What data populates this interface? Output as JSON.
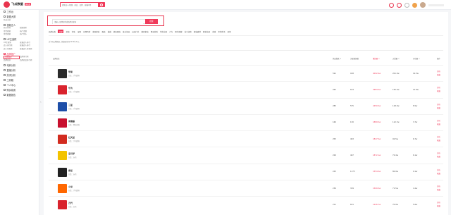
{
  "header": {
    "logo_text": "飞瓜数据",
    "logo_sub": "抖音版",
    "logo_badge": "旗舰版",
    "search_placeholder": "搜索达人/视频、商品、品牌、直播间等",
    "accent_color": "#f03a5a"
  },
  "sidebar": {
    "groups": [
      {
        "label": "工作台",
        "icon": "workbench-icon",
        "subs": []
      },
      {
        "label": "数据大屏",
        "icon": "screen-icon",
        "subs": [
          "作品大屏"
        ]
      },
      {
        "label": "视频达人",
        "icon": "video-icon",
        "subs": [
          "热门素材",
          "视频搜索",
          "带货视频",
          "热门话题",
          "带货视频",
          "热门音乐"
        ]
      },
      {
        "label": "UP主追踪",
        "icon": "track-icon",
        "subs": [
          "UP主搜索",
          "直播达人排行",
          "达人排行榜",
          "直播达人排行",
          "达人带货榜",
          "直播达人带货榜"
        ]
      },
      {
        "label": "品牌推广",
        "icon": "brand-icon",
        "active": true,
        "subs": [
          "品牌搜索",
          "品牌排行榜",
          "品牌投放",
          "品牌商品排行榜"
        ],
        "current_index": 0
      },
      {
        "label": "电商分析",
        "icon": "commerce-icon",
        "subs": []
      },
      {
        "label": "直播分析",
        "icon": "live-icon",
        "subs": []
      },
      {
        "label": "热词分析",
        "icon": "hotword-icon",
        "subs": []
      },
      {
        "label": "工具箱",
        "icon": "toolbox-icon",
        "subs": []
      },
      {
        "label": "个人中心",
        "icon": "user-icon",
        "subs": []
      },
      {
        "label": "购买续费",
        "icon": "purchase-icon",
        "subs": []
      },
      {
        "label": "数据报告",
        "icon": "report-icon",
        "subs": []
      }
    ]
  },
  "main": {
    "search_placeholder": "请输入品牌名称或品牌关键词",
    "search_button": "搜索",
    "categories": [
      "品牌分类",
      "全部",
      "美妆",
      "护肤",
      "母婴",
      "日用百货",
      "家居家纺",
      "服饰",
      "鞋靴",
      "箱包配饰",
      "珠宝饰品",
      "运动户外",
      "数码家电",
      "食品饮料",
      "生鲜水果",
      "汽车",
      "医药保健",
      "花鸟宠物",
      "家装建材",
      "教育培训",
      "游戏",
      "本地生活",
      "其他"
    ],
    "active_category_index": 1,
    "note": "近7天品牌数据，数据更新至2019年4月。",
    "columns": {
      "brand": "品牌信息",
      "trend": "热度指数 ↓",
      "increment": "关联视频数",
      "views": "播放量 ↓",
      "likes": "点赞量 ↓",
      "comments": "评论量 ↓",
      "ops": "操作"
    },
    "rows": [
      {
        "name": "苹果",
        "tags": "分类：手机数码",
        "logo_color": "#2b2b2b",
        "trend": "591",
        "inc": "918",
        "views": "4092.6w",
        "likes": "201.5w",
        "comments": "19.5w",
        "ops": [
          "分析",
          "收藏"
        ]
      },
      {
        "name": "华为",
        "tags": "分类：手机数码",
        "logo_color": "#d9232d",
        "trend": "262",
        "inc": "614",
        "views": "2984.5w",
        "likes": "150.2w",
        "comments": "13.8w",
        "ops": [
          "分析",
          "收藏"
        ]
      },
      {
        "name": "三星",
        "tags": "分类：手机数码",
        "logo_color": "#1d4ea8",
        "trend": "285",
        "inc": "575",
        "views": "2450.5w",
        "likes": "118.5w",
        "comments": "8.5w",
        "ops": [
          "分析",
          "收藏"
        ]
      },
      {
        "name": "肯德基",
        "tags": "分类：食品饮料",
        "logo_color": "#c8102e",
        "trend": "160",
        "inc": "130",
        "views": "1889.5w",
        "likes": "112.7w",
        "comments": "3.7w",
        "ops": [
          "分析",
          "收藏"
        ]
      },
      {
        "name": "红天堂",
        "tags": "分类：手机数码",
        "logo_color": "#d22b1f",
        "trend": "253",
        "inc": "463",
        "views": "1847.5w",
        "likes": "92.5w",
        "comments": "6.7w",
        "ops": [
          "分析",
          "收藏"
        ]
      },
      {
        "name": "宝可梦",
        "tags": "分类：玩具",
        "logo_color": "#f3c300",
        "trend": "229",
        "inc": "467",
        "views": "1872.1w",
        "likes": "72.4w",
        "comments": "6.1w",
        "ops": [
          "分析",
          "收藏"
        ]
      },
      {
        "name": "索尼",
        "tags": "分类：玩具",
        "logo_color": "#222222",
        "trend": "243",
        "inc": "1173",
        "views": "1554.5w",
        "likes": "80.9w",
        "comments": "9.1w",
        "ops": [
          "分析",
          "收藏"
        ]
      },
      {
        "name": "小米",
        "tags": "分类：手机数码",
        "logo_color": "#ff6700",
        "trend": "236",
        "inc": "339",
        "views": "1509.3w",
        "likes": "71.5w",
        "comments": "4.2w",
        "ops": [
          "分析",
          "收藏"
        ]
      },
      {
        "name": "万代",
        "tags": "分类：玩具",
        "logo_color": "#d9232d",
        "trend": "211",
        "inc": "631",
        "views": "1226.7w",
        "likes": "70.9w",
        "comments": "5.6w",
        "ops": [
          "分析",
          "收藏"
        ]
      }
    ]
  }
}
